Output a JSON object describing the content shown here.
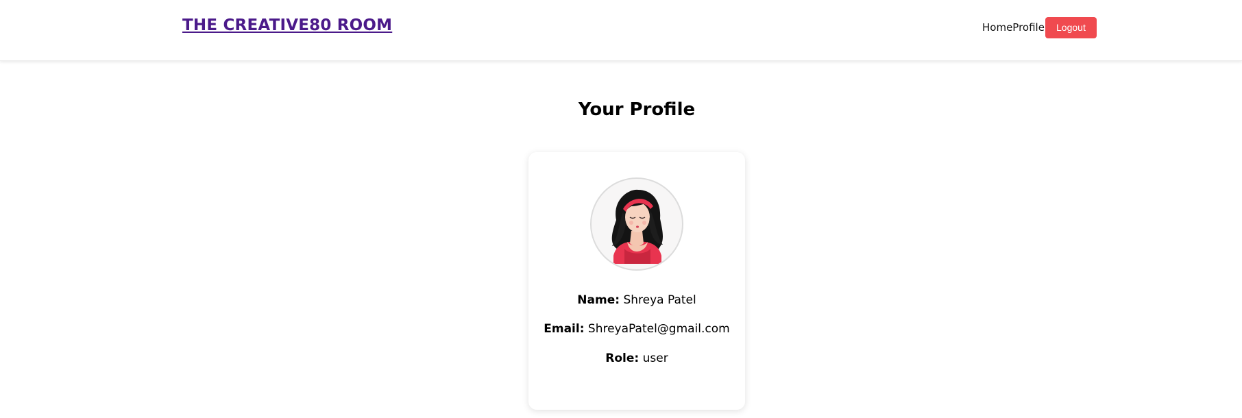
{
  "navbar": {
    "brand": "THE CREATIVE80 ROOM",
    "links": [
      {
        "label": "Home"
      },
      {
        "label": "Profile"
      }
    ],
    "logout_label": "Logout"
  },
  "page": {
    "title": "Your Profile"
  },
  "profile": {
    "avatar_icon": "avatar-woman-illustration",
    "name_label": "Name:",
    "name_value": "Shreya Patel",
    "email_label": "Email:",
    "email_value": "ShreyaPatel@gmail.com",
    "role_label": "Role:",
    "role_value": "user"
  },
  "colors": {
    "brand": "#4b1a8a",
    "logout": "#f04a4f"
  }
}
